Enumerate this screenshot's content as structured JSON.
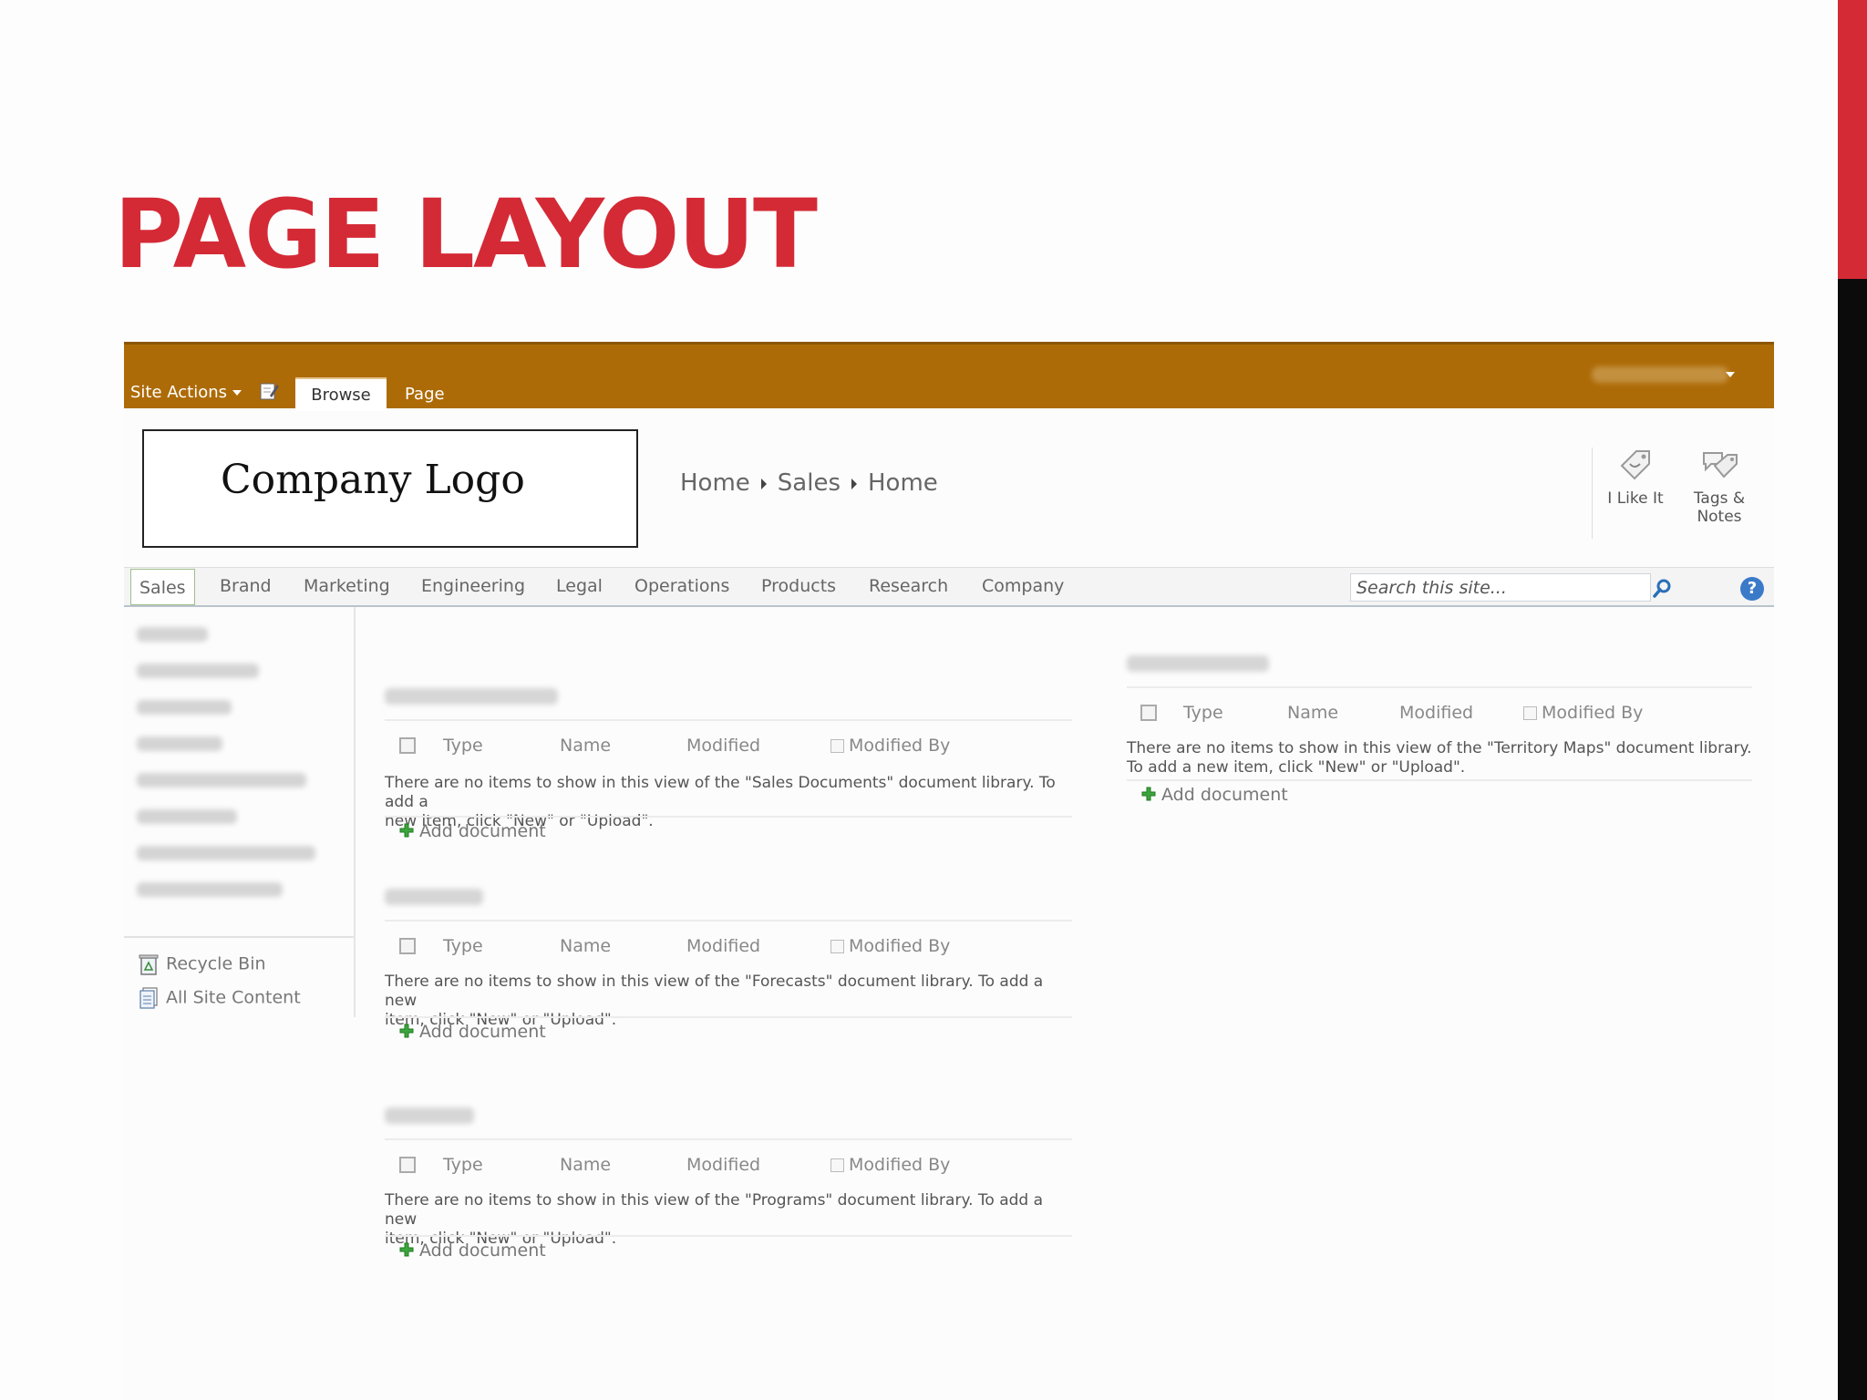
{
  "slide": {
    "title": "PAGE LAYOUT",
    "accent_color": "#d42a36"
  },
  "ribbon": {
    "site_actions": "Site Actions",
    "tabs": [
      {
        "label": "Browse",
        "selected": true
      },
      {
        "label": "Page",
        "selected": false
      }
    ],
    "color": "#ad6b07"
  },
  "header": {
    "logo_text": "Company Logo",
    "breadcrumb": [
      "Home",
      "Sales",
      "Home"
    ],
    "social": [
      {
        "label_line1": "I Like It",
        "label_line2": "",
        "icon": "i-like-it-icon"
      },
      {
        "label_line1": "Tags &",
        "label_line2": "Notes",
        "icon": "tags-notes-icon"
      }
    ]
  },
  "topnav": {
    "items": [
      "Sales",
      "Brand",
      "Marketing",
      "Engineering",
      "Legal",
      "Operations",
      "Products",
      "Research",
      "Company"
    ],
    "selected": "Sales",
    "search_placeholder": "Search this site...",
    "help_icon": "?"
  },
  "leftnav": {
    "recycle_bin": "Recycle Bin",
    "all_site_content": "All Site Content"
  },
  "columns": {
    "type": "Type",
    "name": "Name",
    "modified": "Modified",
    "modified_by": "Modified By"
  },
  "webparts": [
    {
      "msg_line1": "There are no items to show in this view of the \"Sales Documents\" document library. To add a",
      "msg_line2": "new item, click \"New\" or \"Upload\".",
      "add": "Add document"
    },
    {
      "msg_line1": "There are no items to show in this view of the \"Forecasts\" document library. To add a new",
      "msg_line2": "item, click \"New\" or \"Upload\".",
      "add": "Add document"
    },
    {
      "msg_line1": "There are no items to show in this view of the \"Programs\" document library. To add a new",
      "msg_line2": "item, click \"New\" or \"Upload\".",
      "add": "Add document"
    },
    {
      "msg_line1": "There are no items to show in this view of the \"Territory Maps\" document library.",
      "msg_line2": "To add a new item, click \"New\" or \"Upload\".",
      "add": "Add document"
    }
  ]
}
